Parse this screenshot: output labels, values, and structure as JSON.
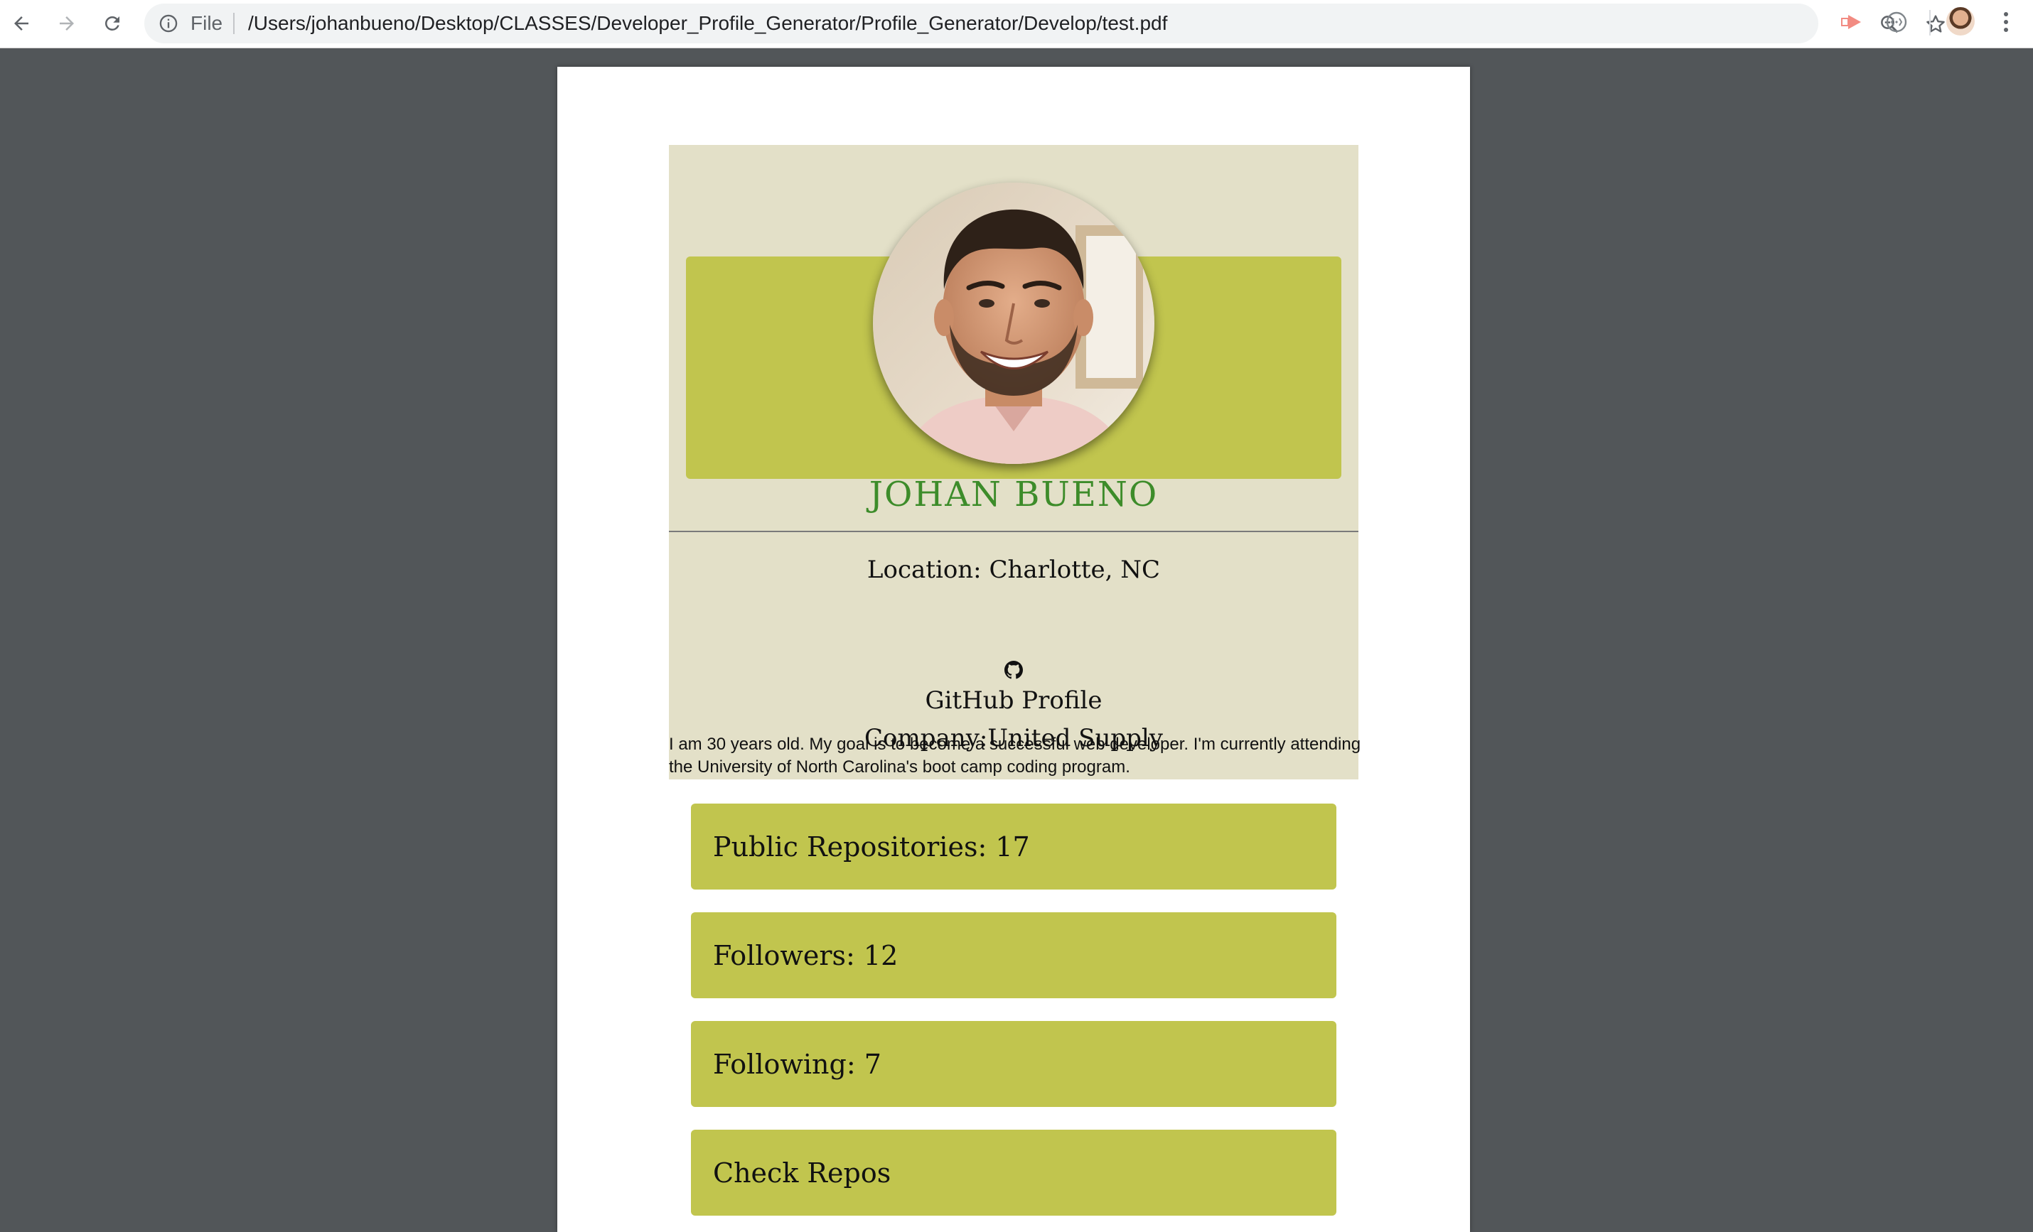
{
  "browser": {
    "omnibox_scheme": "File",
    "url": "/Users/johanbueno/Desktop/CLASSES/Developer_Profile_Generator/Profile_Generator/Develop/test.pdf"
  },
  "profile": {
    "name": "JOHAN BUENO",
    "location": "Location: Charlotte, NC",
    "github_link": "GitHub Profile",
    "company": "Company:United Supply",
    "bio": "I am 30 years old. My goal is to become a successful web developer. I'm currently attending the University of North Carolina's boot camp coding program."
  },
  "stats": [
    {
      "label": "Public Repositories: 17"
    },
    {
      "label": "Followers: 12"
    },
    {
      "label": "Following: 7"
    },
    {
      "label": "Check Repos"
    }
  ],
  "colors": {
    "header_background": "#e3e0c8",
    "accent_green": "#c1c54e",
    "name_green": "#3d8c2a",
    "viewer_background": "#525659"
  },
  "icons": [
    "back-icon",
    "forward-icon",
    "reload-icon",
    "info-icon",
    "zoom-icon",
    "star-icon",
    "extension-icon",
    "devtools-extension-icon",
    "github-icon",
    "menu-icon"
  ]
}
